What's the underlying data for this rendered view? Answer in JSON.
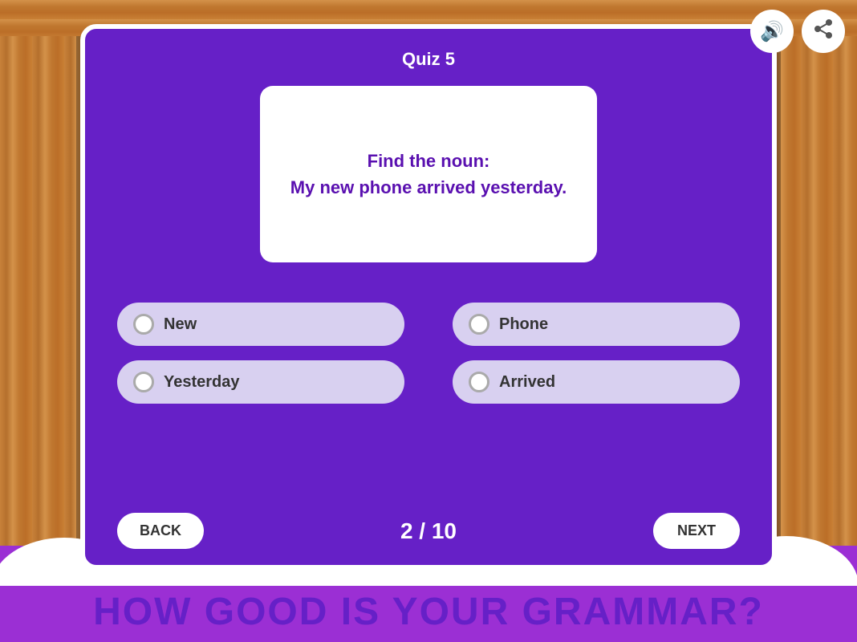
{
  "page": {
    "background_color": "#9b2fd4"
  },
  "quiz": {
    "title": "Quiz 5",
    "question": "Find the noun:\nMy new phone arrived yesterday.",
    "progress_current": 2,
    "progress_total": 10,
    "progress_label": "2 / 10"
  },
  "answers": [
    {
      "id": "new",
      "label": "New",
      "selected": false
    },
    {
      "id": "phone",
      "label": "Phone",
      "selected": false
    },
    {
      "id": "yesterday",
      "label": "Yesterday",
      "selected": false
    },
    {
      "id": "arrived",
      "label": "Arrived",
      "selected": false
    }
  ],
  "buttons": {
    "back": "BACK",
    "next": "NEXT"
  },
  "tagline": "How Good Is Your Grammar?",
  "icons": {
    "sound": "🔊",
    "share": "↗"
  }
}
